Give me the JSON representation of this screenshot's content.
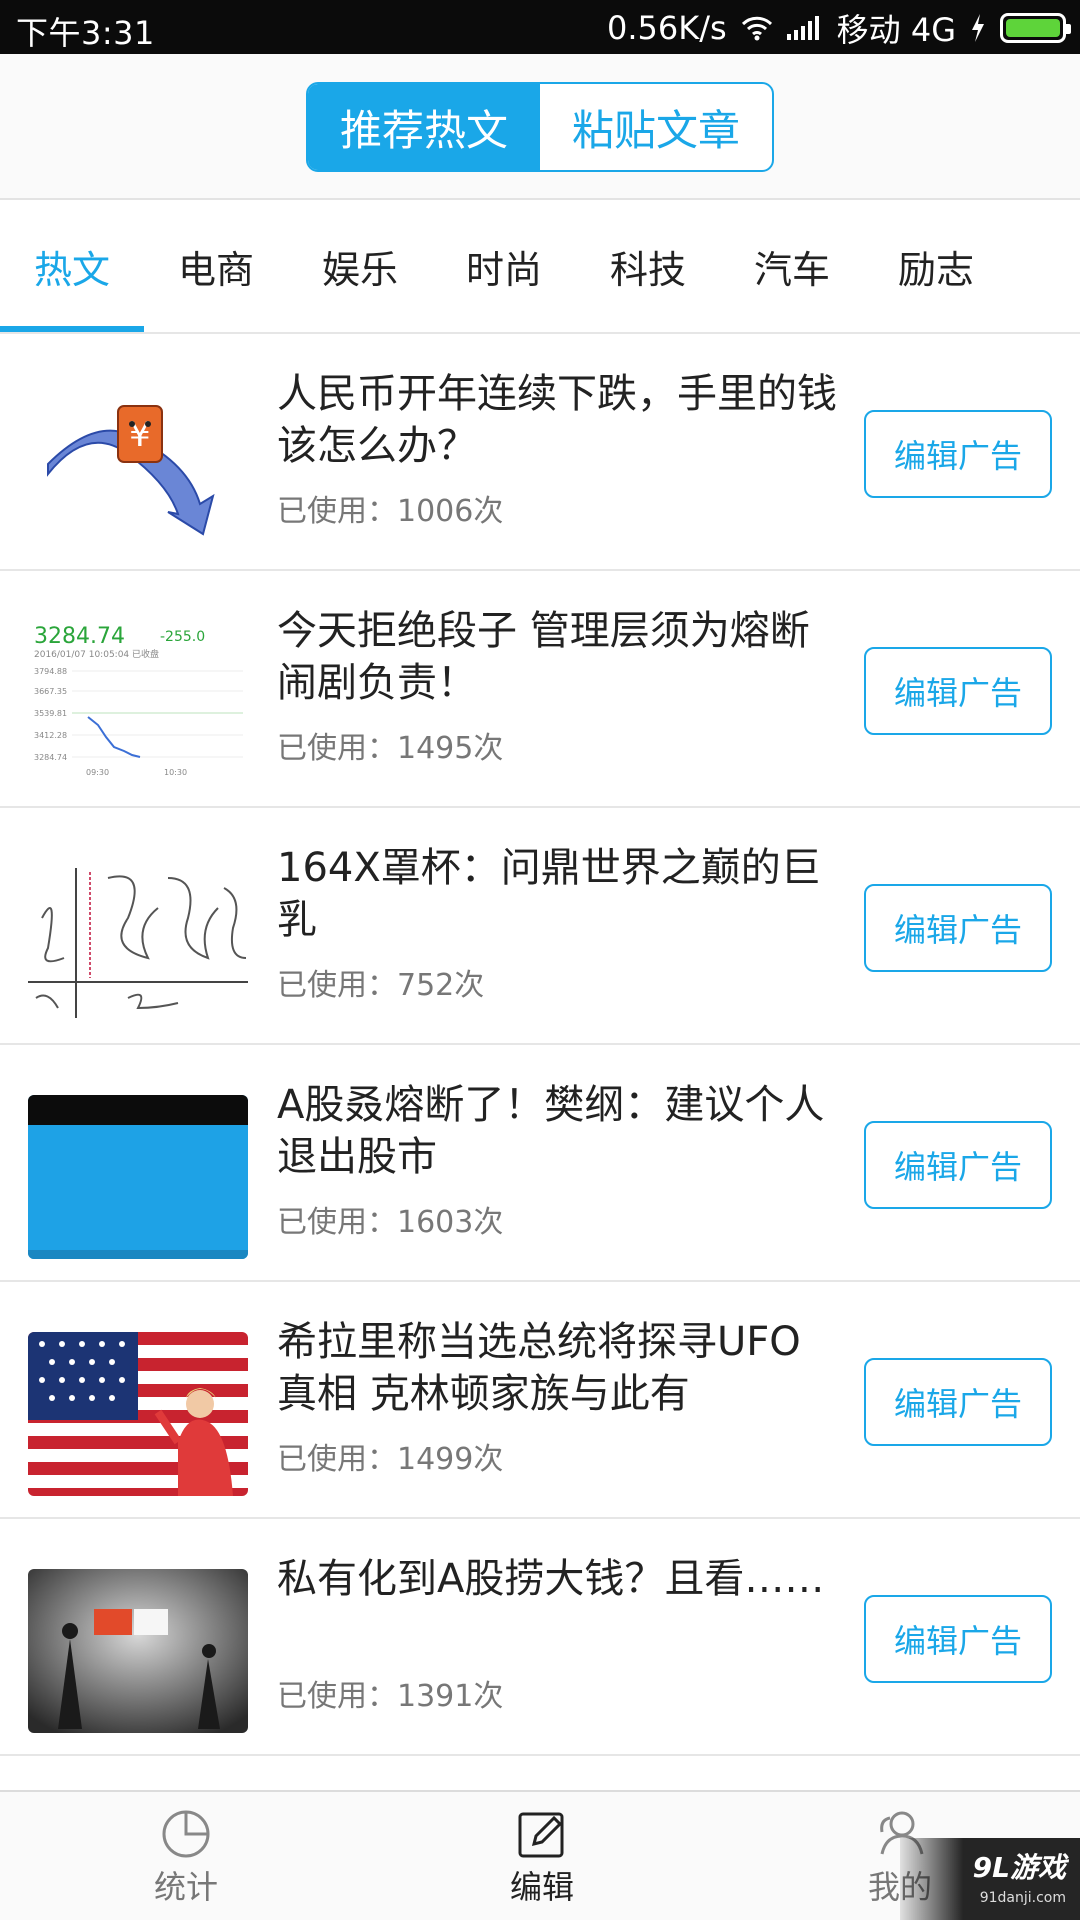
{
  "status_bar": {
    "time": "下午3:31",
    "speed": "0.56K/s",
    "carrier": "移动 4G",
    "battery_color": "#5ed43a"
  },
  "header": {
    "tabs": [
      {
        "label": "推荐热文",
        "active": true
      },
      {
        "label": "粘贴文章",
        "active": false
      }
    ]
  },
  "categories": [
    {
      "label": "热文",
      "active": true
    },
    {
      "label": "电商"
    },
    {
      "label": "娱乐"
    },
    {
      "label": "时尚"
    },
    {
      "label": "科技"
    },
    {
      "label": "汽车"
    },
    {
      "label": "励志"
    }
  ],
  "articles": [
    {
      "title": "人民币开年连续下跌，手里的钱该怎么办？",
      "used_prefix": "已使用：",
      "used_count": "1006次",
      "button": "编辑广告",
      "thumb": "rmb-arrow-icon"
    },
    {
      "title": "今天拒绝段子 管理层须为熔断闹剧负责！",
      "used_prefix": "已使用：",
      "used_count": "1495次",
      "button": "编辑广告",
      "thumb": "stock-chart",
      "thumb_text": {
        "price": "3284.74",
        "change": "-255.0",
        "date": "2016/01/07 10:05:04  已收盘",
        "ticks": [
          "3794.88",
          "3667.35",
          "3539.81",
          "3412.28",
          "3284.74"
        ],
        "times": [
          "09:30",
          "10:30"
        ]
      }
    },
    {
      "title": "164X罩杯：问鼎世界之巅的巨乳",
      "used_prefix": "已使用：",
      "used_count": "752次",
      "button": "编辑广告",
      "thumb": "sketch-drawing"
    },
    {
      "title": "A股叒熔断了！樊纲：建议个人退出股市",
      "used_prefix": "已使用：",
      "used_count": "1603次",
      "button": "编辑广告",
      "thumb": "blue-card"
    },
    {
      "title": "希拉里称当选总统将探寻UFO真相 克林顿家族与此有",
      "used_prefix": "已使用：",
      "used_count": "1499次",
      "button": "编辑广告",
      "thumb": "flag-photo"
    },
    {
      "title": "私有化到A股捞大钱？且看……",
      "used_prefix": "已使用：",
      "used_count": "1391次",
      "button": "编辑广告",
      "thumb": "bw-photo"
    }
  ],
  "bottom_nav": [
    {
      "label": "统计",
      "icon": "pie-chart-icon"
    },
    {
      "label": "编辑",
      "icon": "edit-icon",
      "active": true
    },
    {
      "label": "我的",
      "icon": "users-icon"
    }
  ],
  "watermark": {
    "logo": "9L游戏",
    "url": "91danji.com"
  },
  "colors": {
    "accent": "#1aa7e8"
  }
}
